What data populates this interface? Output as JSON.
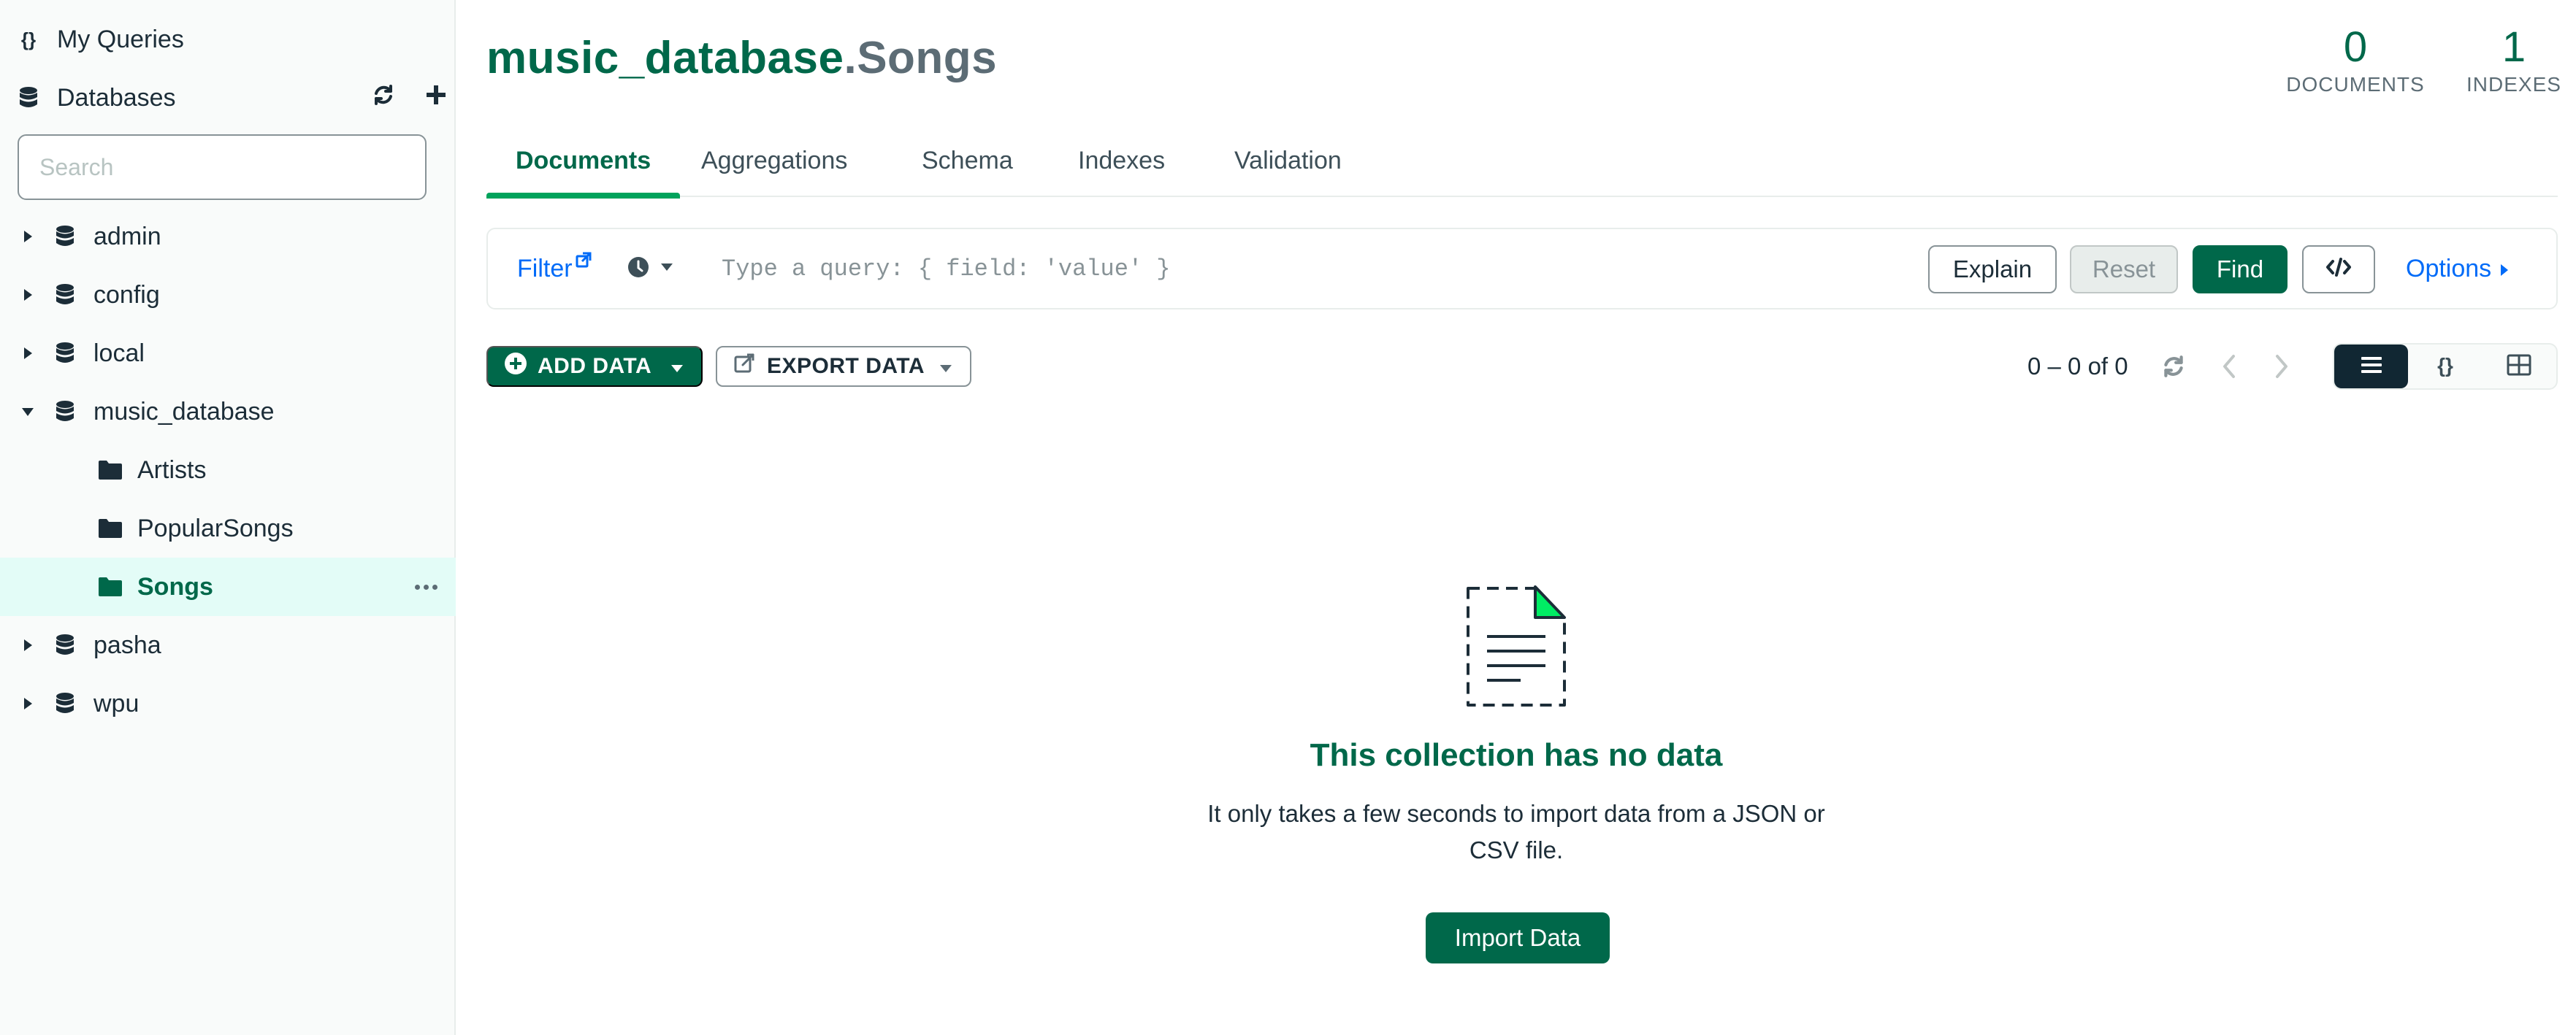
{
  "sidebar": {
    "my_queries_label": "My Queries",
    "databases_label": "Databases",
    "search_placeholder": "Search",
    "databases": [
      {
        "name": "admin",
        "expanded": false
      },
      {
        "name": "config",
        "expanded": false
      },
      {
        "name": "local",
        "expanded": false
      },
      {
        "name": "music_database",
        "expanded": true,
        "collections": [
          "Artists",
          "PopularSongs",
          "Songs"
        ],
        "active_collection": "Songs"
      },
      {
        "name": "pasha",
        "expanded": false
      },
      {
        "name": "wpu",
        "expanded": false
      }
    ]
  },
  "header": {
    "database_name": "music_database",
    "collection_suffix": ".Songs",
    "documents_count": "0",
    "documents_label": "DOCUMENTS",
    "indexes_count": "1",
    "indexes_label": "INDEXES"
  },
  "tabs": [
    {
      "label": "Documents",
      "active": true
    },
    {
      "label": "Aggregations",
      "active": false
    },
    {
      "label": "Schema",
      "active": false
    },
    {
      "label": "Indexes",
      "active": false
    },
    {
      "label": "Validation",
      "active": false
    }
  ],
  "query_bar": {
    "filter_label": "Filter",
    "placeholder": "Type a query: { field: 'value' }",
    "explain_label": "Explain",
    "reset_label": "Reset",
    "find_label": "Find",
    "options_label": "Options"
  },
  "toolbar": {
    "add_data_label": "ADD DATA",
    "export_data_label": "EXPORT DATA",
    "pagination_text": "0 – 0 of 0"
  },
  "empty_state": {
    "title": "This collection has no data",
    "description": "It only takes a few seconds to import data from a JSON or CSV file.",
    "import_button_label": "Import Data"
  },
  "colors": {
    "brand_green": "#00684a",
    "accent_green": "#00a35c",
    "link_blue": "#016bf8",
    "active_row_bg": "#e3fcf7"
  }
}
